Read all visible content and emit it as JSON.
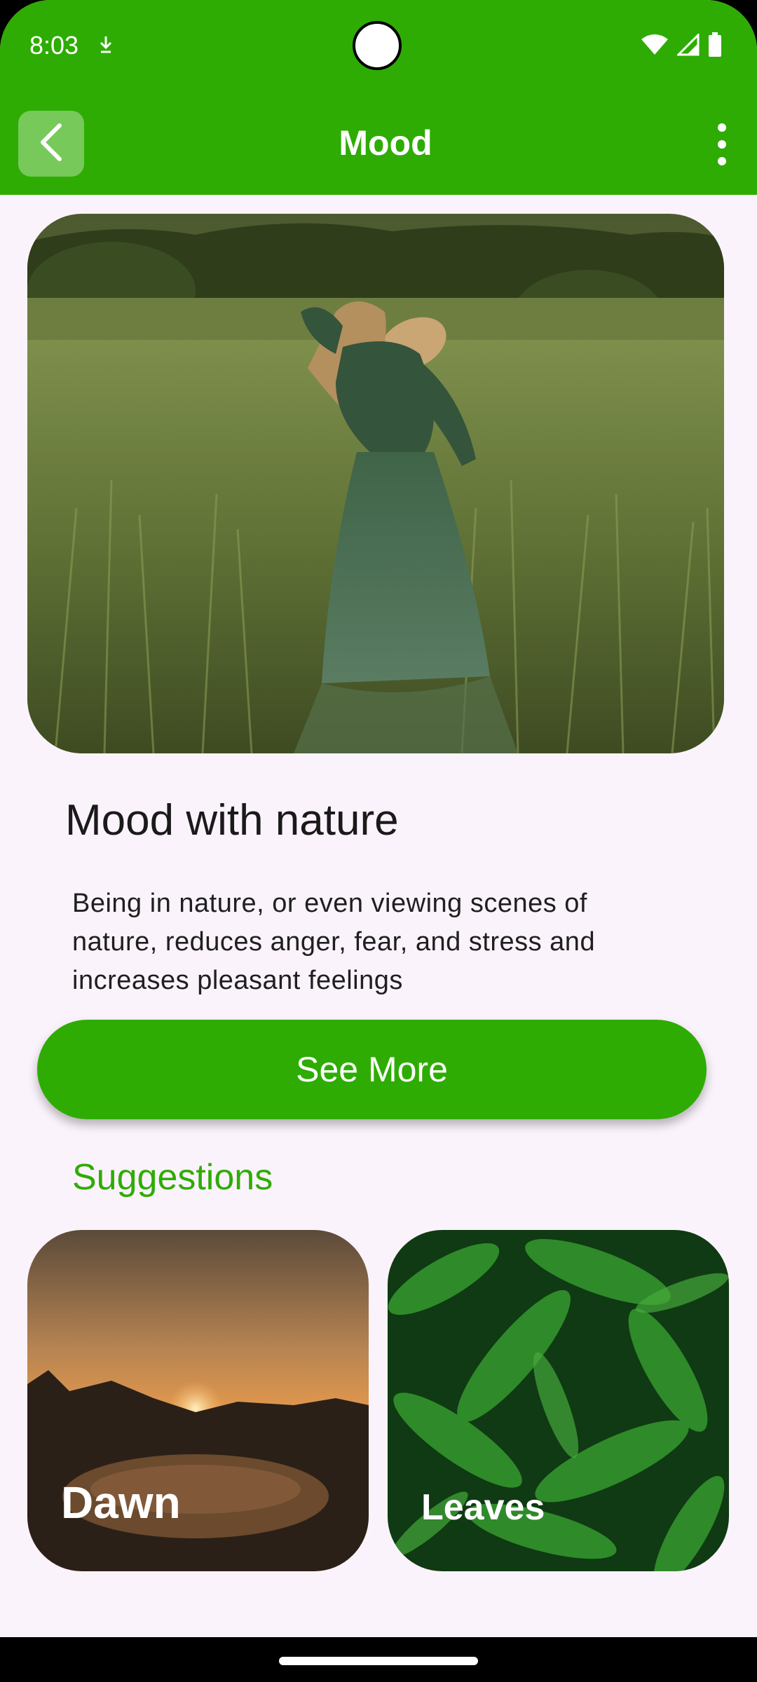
{
  "status_bar": {
    "time": "8:03",
    "icons": [
      "download-indicator-icon",
      "wifi-icon",
      "cellular-signal-icon",
      "battery-icon"
    ]
  },
  "app_bar": {
    "title": "Mood",
    "back_icon": "chevron-left-icon",
    "menu_icon": "more-vertical-icon"
  },
  "hero": {
    "image": "woman-in-wheat-field-photo"
  },
  "content": {
    "headline": "Mood with nature",
    "description": "Being in nature, or even viewing scenes of nature, reduces anger, fear, and stress and increases pleasant feelings",
    "button_label": "See More"
  },
  "suggestions": {
    "title": "Suggestions",
    "items": [
      {
        "label": "Dawn",
        "image": "sunset-over-bay-photo"
      },
      {
        "label": "Leaves",
        "image": "fern-leaves-photo"
      }
    ]
  },
  "colors": {
    "primary": "#2eac03",
    "background": "#fbf3fb",
    "text": "#1a1a1a"
  }
}
